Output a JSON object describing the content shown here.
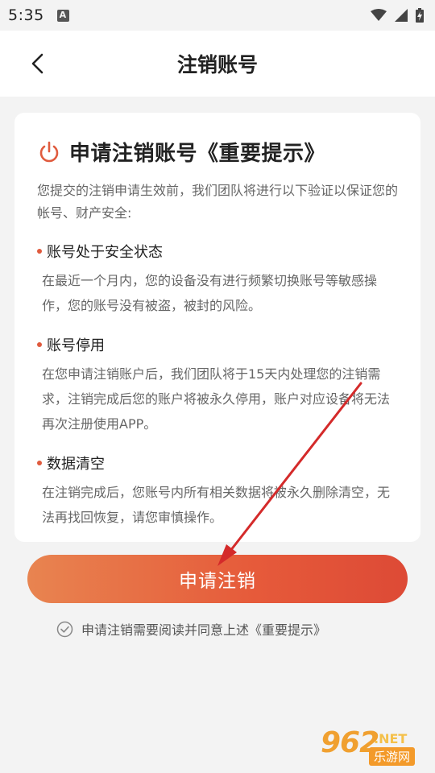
{
  "status_bar": {
    "time": "5:35"
  },
  "header": {
    "title": "注销账号"
  },
  "card": {
    "title": "申请注销账号《重要提示》",
    "intro": "您提交的注销申请生效前，我们团队将进行以下验证以保证您的帐号、财产安全:",
    "sections": [
      {
        "title": "账号处于安全状态",
        "text": "在最近一个月内，您的设备没有进行频繁切换账号等敏感操作，您的账号没有被盗，被封的风险。"
      },
      {
        "title": "账号停用",
        "text": "在您申请注销账户后，我们团队将于15天内处理您的注销需求，注销完成后您的账户将被永久停用，账户对应设备将无法再次注册使用APP。"
      },
      {
        "title": "数据清空",
        "text": "在注销完成后，您账号内所有相关数据将被永久删除清空，无法再找回恢复，请您审慎操作。"
      }
    ]
  },
  "actions": {
    "apply_label": "申请注销",
    "agree_text": "申请注销需要阅读并同意上述《重要提示》"
  },
  "watermark": {
    "number": "962",
    "suffix": ".NET",
    "site_cn": "乐游网"
  },
  "colors": {
    "accent": "#e65a3a",
    "annotation_arrow": "#d42a2a"
  },
  "icons": {
    "back": "chevron-left-icon",
    "power": "power-icon",
    "check": "check-circle-icon",
    "wifi": "wifi-icon",
    "signal": "signal-icon",
    "battery": "battery-icon"
  }
}
